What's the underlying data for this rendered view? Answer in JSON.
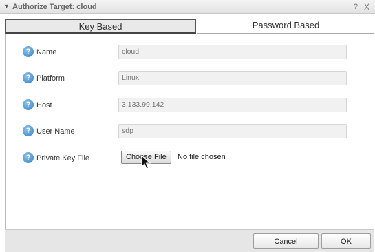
{
  "window": {
    "title": "Authorize Target: cloud",
    "collapse_glyph": "▼",
    "help_label": "?",
    "close_label": "X"
  },
  "tabs": [
    {
      "label": "Key Based",
      "active": true
    },
    {
      "label": "Password Based",
      "active": false
    }
  ],
  "form": {
    "help_icon_glyph": "?",
    "fields": [
      {
        "label": "Name",
        "value": "cloud"
      },
      {
        "label": "Platform",
        "value": "Linux"
      },
      {
        "label": "Host",
        "value": "3.133.99.142"
      },
      {
        "label": "User Name",
        "value": "sdp"
      }
    ],
    "private_key": {
      "label": "Private Key File",
      "button_label": "Choose File",
      "status": "No file chosen"
    }
  },
  "footer": {
    "cancel_label": "Cancel",
    "ok_label": "OK"
  },
  "colors": {
    "help_icon": "#2f7fc4",
    "field_bg": "#f1f1f1",
    "footer_bg": "#e6e6e6"
  }
}
